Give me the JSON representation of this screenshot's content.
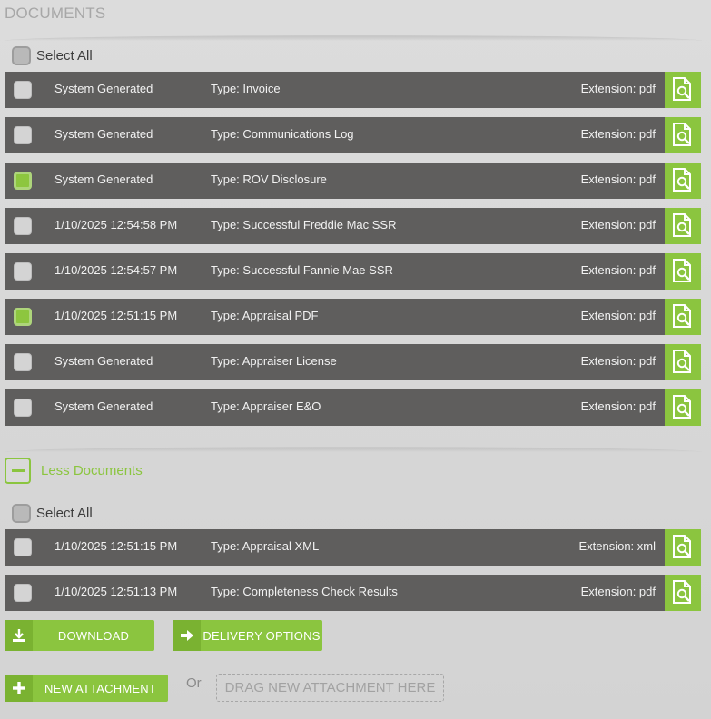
{
  "section_title": "DOCUMENTS",
  "select_all_label": "Select All",
  "documents": [
    {
      "date": "System Generated",
      "type": "Type: Invoice",
      "extension": "Extension: pdf",
      "checked": false
    },
    {
      "date": "System Generated",
      "type": "Type: Communications Log",
      "extension": "Extension: pdf",
      "checked": false
    },
    {
      "date": "System Generated",
      "type": "Type: ROV Disclosure",
      "extension": "Extension: pdf",
      "checked": true
    },
    {
      "date": "1/10/2025 12:54:58 PM",
      "type": "Type: Successful Freddie Mac SSR",
      "extension": "Extension: pdf",
      "checked": false
    },
    {
      "date": "1/10/2025 12:54:57 PM",
      "type": "Type: Successful Fannie Mae SSR",
      "extension": "Extension: pdf",
      "checked": false
    },
    {
      "date": "1/10/2025 12:51:15 PM",
      "type": "Type: Appraisal PDF",
      "extension": "Extension: pdf",
      "checked": true
    },
    {
      "date": "System Generated",
      "type": "Type: Appraiser License",
      "extension": "Extension: pdf",
      "checked": false
    },
    {
      "date": "System Generated",
      "type": "Type: Appraiser E&O",
      "extension": "Extension: pdf",
      "checked": false
    }
  ],
  "less_documents_label": "Less Documents",
  "extra_documents": [
    {
      "date": "1/10/2025 12:51:15 PM",
      "type": "Type: Appraisal XML",
      "extension": "Extension: xml",
      "checked": false
    },
    {
      "date": "1/10/2025 12:51:13 PM",
      "type": "Type: Completeness Check Results",
      "extension": "Extension: pdf",
      "checked": false
    }
  ],
  "actions": {
    "download_label": "DOWNLOAD",
    "delivery_options_label": "DELIVERY OPTIONS",
    "new_attachment_label": "NEW ATTACHMENT",
    "or_label": "Or",
    "drop_zone_label": "DRAG NEW ATTACHMENT HERE"
  },
  "icons": {
    "view_document": "document-search-icon",
    "download": "download-icon",
    "delivery": "arrow-right-icon",
    "add": "plus-icon"
  },
  "colors": {
    "accent": "#8bc53f",
    "row_bg": "#5f5e5d"
  }
}
